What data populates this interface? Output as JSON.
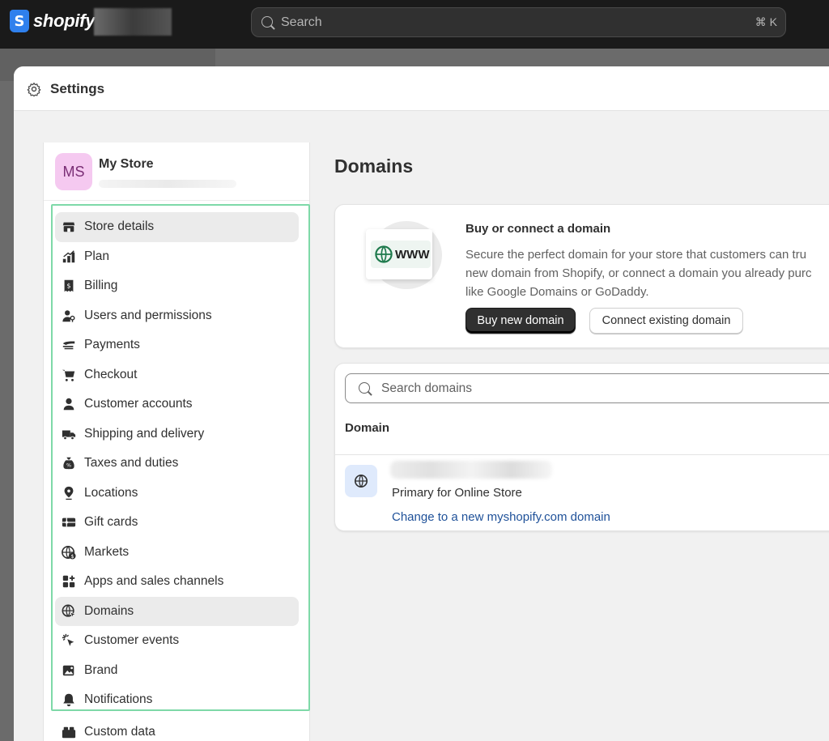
{
  "topbar": {
    "logo_letter": "S",
    "logo_text": "shopify",
    "search_placeholder": "Search",
    "search_shortcut": "⌘ K"
  },
  "window": {
    "title": "Settings",
    "icon": "gear-icon"
  },
  "sidebar": {
    "store_initials": "MS",
    "store_name": "My Store",
    "items": [
      {
        "label": "Store details",
        "icon": "store-icon",
        "active": true
      },
      {
        "label": "Plan",
        "icon": "plan-icon"
      },
      {
        "label": "Billing",
        "icon": "billing-icon"
      },
      {
        "label": "Users and permissions",
        "icon": "users-icon"
      },
      {
        "label": "Payments",
        "icon": "payments-icon"
      },
      {
        "label": "Checkout",
        "icon": "cart-icon"
      },
      {
        "label": "Customer accounts",
        "icon": "person-icon"
      },
      {
        "label": "Shipping and delivery",
        "icon": "truck-icon"
      },
      {
        "label": "Taxes and duties",
        "icon": "tax-bag-icon"
      },
      {
        "label": "Locations",
        "icon": "location-pin-icon"
      },
      {
        "label": "Gift cards",
        "icon": "gift-card-icon"
      },
      {
        "label": "Markets",
        "icon": "globe-dollar-icon"
      },
      {
        "label": "Apps and sales channels",
        "icon": "apps-icon"
      },
      {
        "label": "Domains",
        "icon": "globe-cursor-icon",
        "active": true
      },
      {
        "label": "Customer events",
        "icon": "cursor-click-icon"
      },
      {
        "label": "Brand",
        "icon": "brand-image-icon"
      },
      {
        "label": "Notifications",
        "icon": "bell-icon"
      }
    ],
    "extra_item": {
      "label": "Custom data",
      "icon": "custom-data-icon"
    }
  },
  "main": {
    "title": "Domains",
    "promo": {
      "badge_text": "WWW",
      "title": "Buy or connect a domain",
      "body_lines": [
        "Secure the perfect domain for your store that customers can tru",
        "new domain from Shopify, or connect a domain you already purc",
        "like Google Domains or GoDaddy."
      ],
      "primary_button": "Buy new domain",
      "secondary_button": "Connect existing domain"
    },
    "domains": {
      "search_placeholder": "Search domains",
      "column_header": "Domain",
      "rows": [
        {
          "subtitle": "Primary for Online Store",
          "link": "Change to a new myshopify.com domain"
        }
      ]
    }
  },
  "colors": {
    "topbar_bg": "#1a1a1a",
    "accent_green_outline": "#7ed9a8",
    "avatar_bg": "#f5c9f0",
    "link_blue": "#1f5199",
    "primary_button_bg": "#303030"
  }
}
